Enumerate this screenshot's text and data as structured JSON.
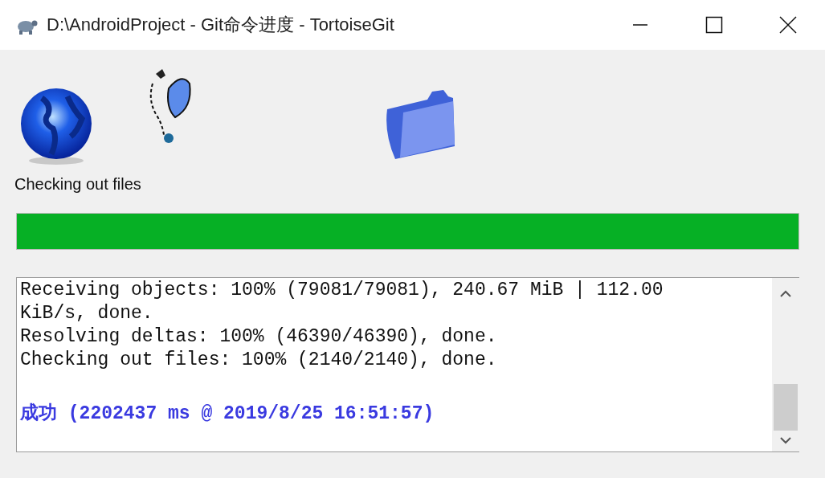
{
  "window": {
    "title": "D:\\AndroidProject - Git命令进度 - TortoiseGit"
  },
  "status": {
    "label": "Checking out files"
  },
  "progress": {
    "level": 1
  },
  "log": [
    {
      "kind": "normal",
      "text": "Receiving objects: 100% (79081/79081), 240.67 MiB | 112.00"
    },
    {
      "kind": "normal",
      "text": "KiB/s, done."
    },
    {
      "kind": "normal",
      "text": "Resolving deltas: 100% (46390/46390), done."
    },
    {
      "kind": "normal",
      "text": "Checking out files: 100% (2140/2140), done."
    },
    {
      "kind": "success",
      "text": "成功 (2202437 ms @ 2019/8/25 16:51:57)"
    }
  ]
}
